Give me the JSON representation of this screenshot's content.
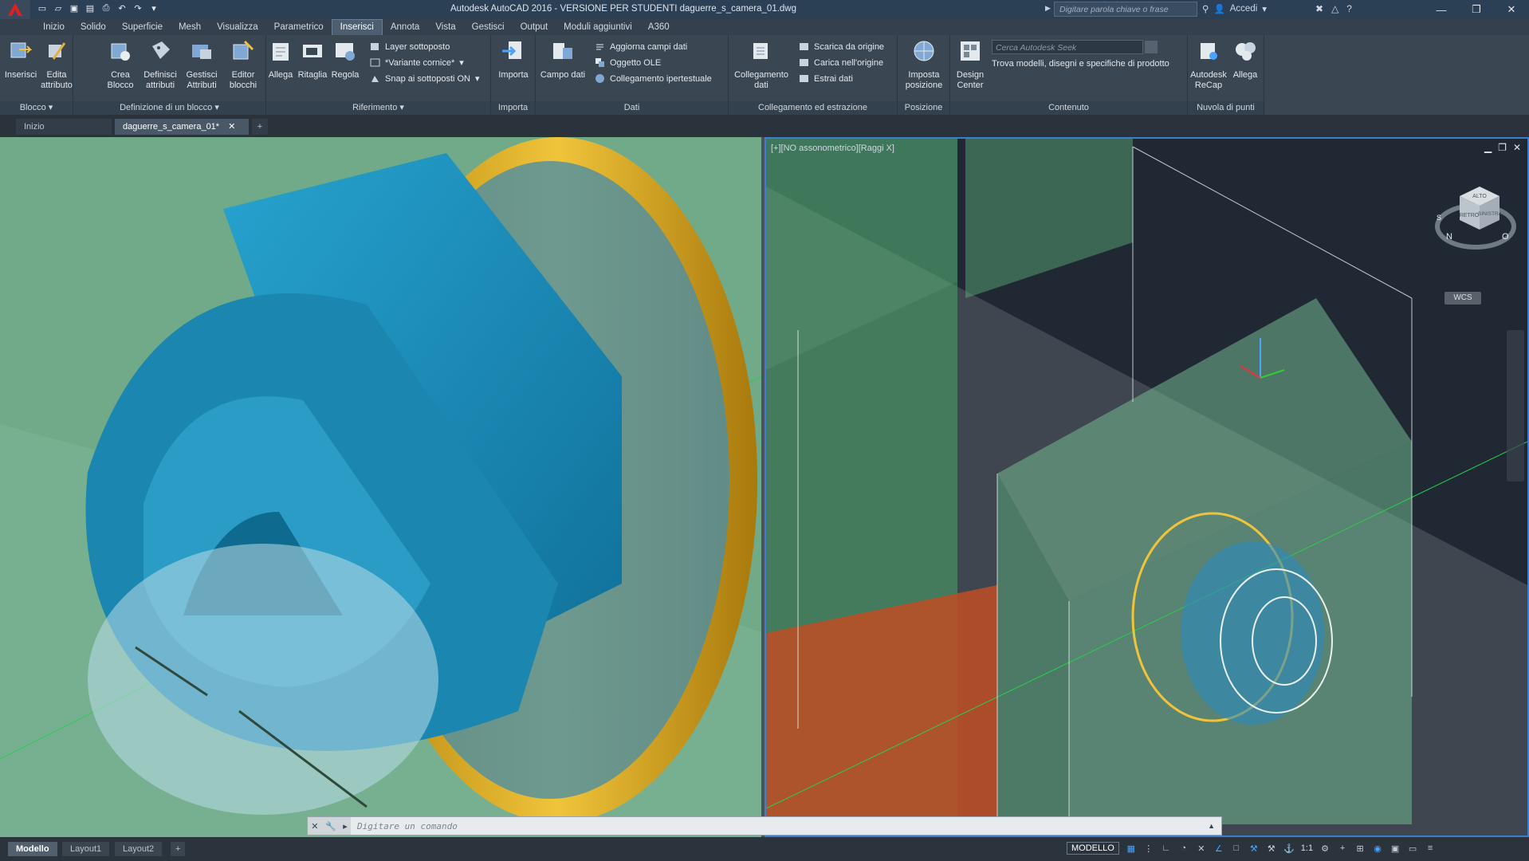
{
  "window": {
    "title": "Autodesk AutoCAD 2016 - VERSIONE PER STUDENTI    daguerre_s_camera_01.dwg",
    "search_placeholder": "Digitare parola chiave o frase",
    "login_label": "Accedi"
  },
  "ribbon_tabs": [
    "Inizio",
    "Solido",
    "Superficie",
    "Mesh",
    "Visualizza",
    "Parametrico",
    "Inserisci",
    "Annota",
    "Vista",
    "Gestisci",
    "Output",
    "Moduli aggiuntivi",
    "A360"
  ],
  "active_ribbon_tab": "Inserisci",
  "ribbon": {
    "blocco": {
      "title": "Blocco",
      "inserisci": "Inserisci",
      "edita": "Edita attributo"
    },
    "definizione": {
      "title": "Definizione di un blocco",
      "crea": "Crea Blocco",
      "definisci": "Definisci attributi",
      "gestisci": "Gestisci Attributi",
      "editor": "Editor blocchi"
    },
    "riferimento": {
      "title": "Riferimento",
      "allega": "Allega",
      "ritaglia": "Ritaglia",
      "regola": "Regola",
      "layer": "Layer sottoposto",
      "variante": "*Variante cornice*",
      "snap": "Snap ai sottoposti ON"
    },
    "importa": {
      "title": "Importa",
      "importa": "Importa"
    },
    "dati": {
      "title": "Dati",
      "campo": "Campo dati",
      "aggiorna": "Aggiorna campi dati",
      "ole": "Oggetto OLE",
      "collegamento": "Collegamento ipertestuale"
    },
    "collegamento": {
      "title": "Collegamento ed estrazione",
      "coll_dati": "Collegamento dati",
      "scarica": "Scarica da origine",
      "carica": "Carica nell'origine",
      "estrai": "Estrai  dati"
    },
    "posizione": {
      "title": "Posizione",
      "imposta": "Imposta posizione"
    },
    "contenuto": {
      "title": "Contenuto",
      "design": "Design Center",
      "seek_placeholder": "Cerca Autodesk Seek",
      "seek_desc": "Trova modelli, disegni e specifiche di prodotto"
    },
    "nuvola": {
      "title": "Nuvola di punti",
      "recap": "Autodesk ReCap",
      "allega": "Allega"
    }
  },
  "file_tabs": {
    "home": "Inizio",
    "active": "daguerre_s_camera_01*"
  },
  "viewport_right": {
    "label": "[+][NO assonometrico][Raggi X]",
    "wcs": "WCS",
    "cube_top": "ALTO",
    "cube_front": "RETRO",
    "cube_right": "SINISTRA",
    "compass_n": "N",
    "compass_o": "O",
    "compass_s": "S"
  },
  "command": {
    "placeholder": "Digitare un comando"
  },
  "layout_tabs": [
    "Modello",
    "Layout1",
    "Layout2"
  ],
  "active_layout": "Modello",
  "status": {
    "mode": "MODELLO",
    "scale": "1:1"
  },
  "colors": {
    "accent": "#3a7fd0",
    "title_bar": "#2b3f55",
    "ribbon": "#3b4653",
    "lens_blue": "#1b86b0",
    "brass": "#d8a21a"
  }
}
